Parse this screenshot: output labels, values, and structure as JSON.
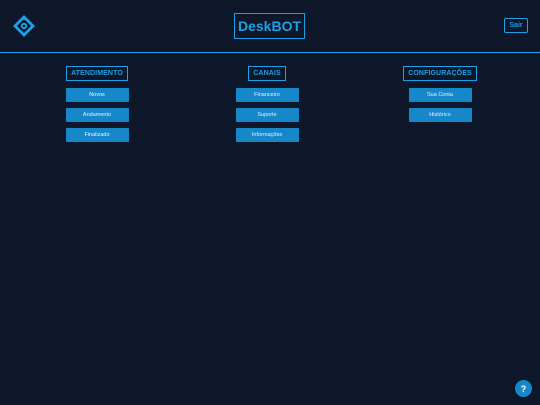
{
  "header": {
    "logo_icon": "robot-diamond-icon",
    "title": "DeskBOT",
    "logout_label": "Sair"
  },
  "sections": [
    {
      "title": "ATENDIMENTO",
      "buttons": [
        "Novos",
        "Andamento",
        "Finalizado"
      ]
    },
    {
      "title": "CANAIS",
      "buttons": [
        "Financeiro",
        "Suporte",
        "Informações"
      ]
    },
    {
      "title": "CONFIGURAÇÕES",
      "buttons": [
        "Sua Conta",
        "Histórico"
      ]
    }
  ],
  "help": {
    "label": "?",
    "icon": "help-icon"
  },
  "colors": {
    "background": "#0f172a",
    "accent": "#1ea0e6",
    "button": "#1688c9"
  }
}
